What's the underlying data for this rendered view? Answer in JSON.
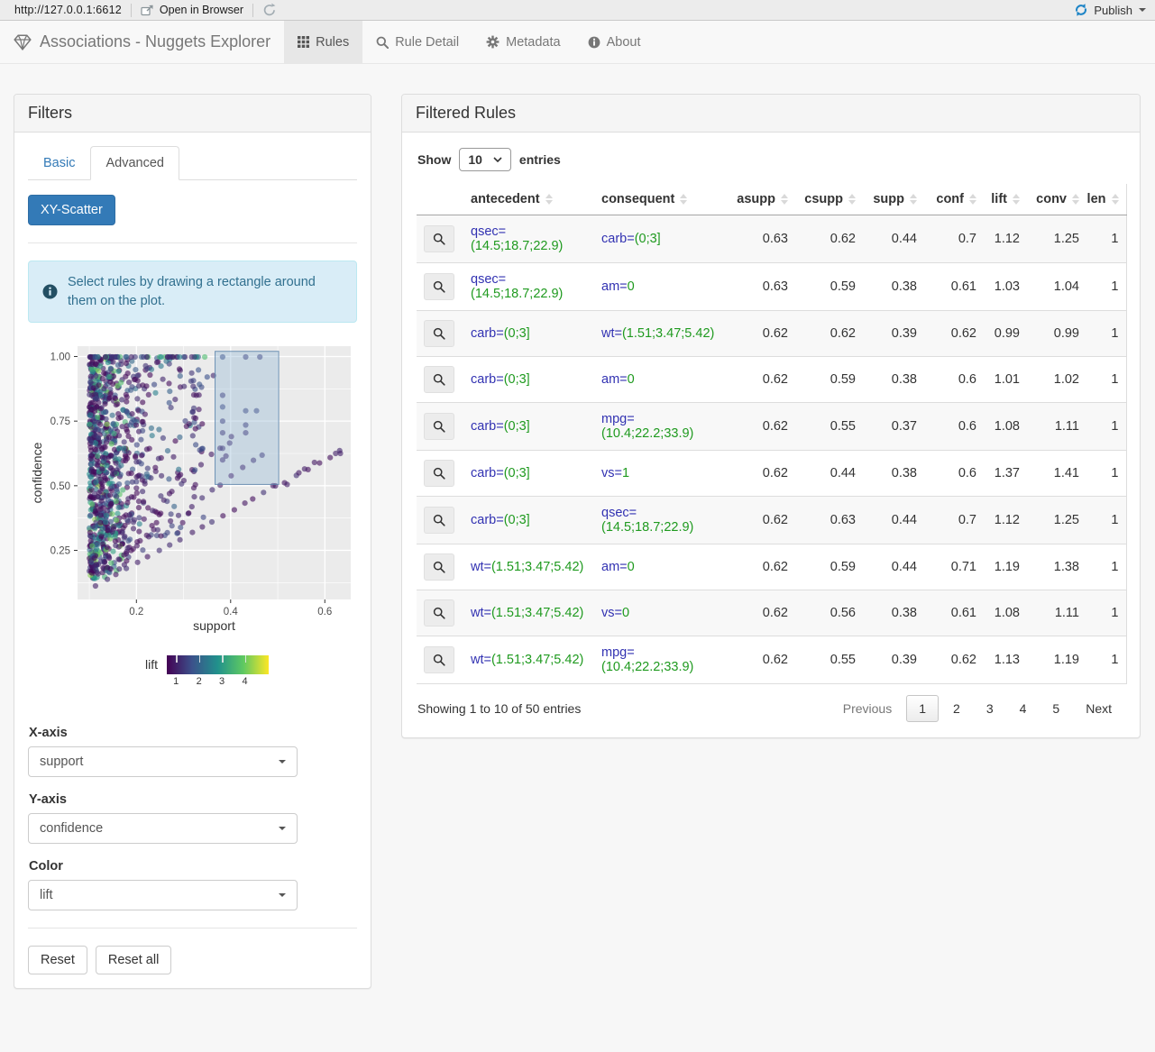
{
  "browser_bar": {
    "url": "http://127.0.0.1:6612",
    "open_in_browser": "Open in Browser",
    "publish": "Publish"
  },
  "navbar": {
    "title": "Associations - Nuggets Explorer",
    "tabs": [
      {
        "label": "Rules",
        "icon": "table-icon",
        "active": true
      },
      {
        "label": "Rule Detail",
        "icon": "search-icon",
        "active": false
      },
      {
        "label": "Metadata",
        "icon": "gear-icon",
        "active": false
      },
      {
        "label": "About",
        "icon": "info-icon",
        "active": false
      }
    ]
  },
  "filters": {
    "title": "Filters",
    "tabs": [
      {
        "label": "Basic",
        "active": false
      },
      {
        "label": "Advanced",
        "active": true
      }
    ],
    "scatter_button": "XY-Scatter",
    "info_text": "Select rules by drawing a rectangle around them on the plot.",
    "x_axis": {
      "label": "X-axis",
      "value": "support"
    },
    "y_axis": {
      "label": "Y-axis",
      "value": "confidence"
    },
    "color": {
      "label": "Color",
      "value": "lift"
    },
    "reset": "Reset",
    "reset_all": "Reset all"
  },
  "chart_data": {
    "type": "scatter",
    "xlabel": "support",
    "ylabel": "confidence",
    "xlim": [
      0.075,
      0.655
    ],
    "ylim": [
      0.06,
      1.04
    ],
    "xticks": [
      0.2,
      0.4,
      0.6
    ],
    "yticks": [
      0.25,
      0.5,
      0.75,
      1.0
    ],
    "grid": true,
    "panel_bg": "#ebebeb",
    "color_legend": {
      "label": "lift",
      "ticks": [
        1,
        2,
        3,
        4
      ],
      "domain": [
        0.6,
        5.04
      ],
      "palette": "viridis"
    },
    "selection_rect": {
      "x": [
        0.367,
        0.502
      ],
      "y": [
        0.505,
        1.02
      ]
    },
    "point_style": {
      "radius": 3.1,
      "opacity": 0.6
    },
    "generated_points": {
      "seed": 42,
      "n_cluster": 950,
      "n_top_row": 55,
      "cluster_support": [
        0.1,
        0.345
      ],
      "arms": [
        [
          1.0,
          24,
          0.63
        ],
        [
          1.33,
          17,
          0.47
        ],
        [
          1.72,
          15,
          0.4
        ]
      ],
      "n_mid_fill": 22
    },
    "selection_points": [
      [
        0.383,
        0.998,
        1.6
      ],
      [
        0.432,
        0.998,
        1.35
      ],
      [
        0.462,
        0.998,
        1.35
      ],
      [
        0.383,
        0.85,
        1.3
      ],
      [
        0.383,
        0.805,
        1.5
      ],
      [
        0.432,
        0.79,
        1.45
      ],
      [
        0.455,
        0.79,
        1.5
      ],
      [
        0.383,
        0.75,
        1.3
      ],
      [
        0.432,
        0.735,
        1.3
      ],
      [
        0.383,
        0.705,
        1.2
      ],
      [
        0.432,
        0.705,
        1.2
      ],
      [
        0.398,
        0.665,
        1.1
      ],
      [
        0.383,
        0.645,
        1.15
      ],
      [
        0.39,
        0.615,
        1.0
      ],
      [
        0.383,
        0.6,
        1.05
      ],
      [
        0.49,
        0.5,
        0.9
      ],
      [
        0.52,
        0.505,
        0.95
      ],
      [
        0.545,
        0.55,
        0.9
      ],
      [
        0.557,
        0.565,
        0.95
      ],
      [
        0.578,
        0.59,
        0.9
      ],
      [
        0.623,
        0.625,
        1.0
      ],
      [
        0.633,
        0.625,
        1.0
      ]
    ]
  },
  "table": {
    "title": "Filtered Rules",
    "show_label": "Show",
    "page_size": "10",
    "entries_label": "entries",
    "columns": [
      "antecedent",
      "consequent",
      "asupp",
      "csupp",
      "supp",
      "conf",
      "lift",
      "conv",
      "len"
    ],
    "rows": [
      {
        "antecedent": {
          "attr": "qsec=",
          "val": "(14.5;18.7;22.9)"
        },
        "consequent": {
          "attr": "carb=",
          "val": "(0;3]"
        },
        "asupp": "0.63",
        "csupp": "0.62",
        "supp": "0.44",
        "conf": "0.7",
        "lift": "1.12",
        "conv": "1.25",
        "len": "1"
      },
      {
        "antecedent": {
          "attr": "qsec=",
          "val": "(14.5;18.7;22.9)"
        },
        "consequent": {
          "attr": "am=",
          "val": "0"
        },
        "asupp": "0.63",
        "csupp": "0.59",
        "supp": "0.38",
        "conf": "0.61",
        "lift": "1.03",
        "conv": "1.04",
        "len": "1"
      },
      {
        "antecedent": {
          "attr": "carb=",
          "val": "(0;3]"
        },
        "consequent": {
          "attr": "wt=",
          "val": "(1.51;3.47;5.42)"
        },
        "asupp": "0.62",
        "csupp": "0.62",
        "supp": "0.39",
        "conf": "0.62",
        "lift": "0.99",
        "conv": "0.99",
        "len": "1"
      },
      {
        "antecedent": {
          "attr": "carb=",
          "val": "(0;3]"
        },
        "consequent": {
          "attr": "am=",
          "val": "0"
        },
        "asupp": "0.62",
        "csupp": "0.59",
        "supp": "0.38",
        "conf": "0.6",
        "lift": "1.01",
        "conv": "1.02",
        "len": "1"
      },
      {
        "antecedent": {
          "attr": "carb=",
          "val": "(0;3]"
        },
        "consequent": {
          "attr": "mpg=",
          "val": "(10.4;22.2;33.9)"
        },
        "asupp": "0.62",
        "csupp": "0.55",
        "supp": "0.37",
        "conf": "0.6",
        "lift": "1.08",
        "conv": "1.11",
        "len": "1"
      },
      {
        "antecedent": {
          "attr": "carb=",
          "val": "(0;3]"
        },
        "consequent": {
          "attr": "vs=",
          "val": "1"
        },
        "asupp": "0.62",
        "csupp": "0.44",
        "supp": "0.38",
        "conf": "0.6",
        "lift": "1.37",
        "conv": "1.41",
        "len": "1"
      },
      {
        "antecedent": {
          "attr": "carb=",
          "val": "(0;3]"
        },
        "consequent": {
          "attr": "qsec=",
          "val": "(14.5;18.7;22.9)"
        },
        "asupp": "0.62",
        "csupp": "0.63",
        "supp": "0.44",
        "conf": "0.7",
        "lift": "1.12",
        "conv": "1.25",
        "len": "1"
      },
      {
        "antecedent": {
          "attr": "wt=",
          "val": "(1.51;3.47;5.42)"
        },
        "consequent": {
          "attr": "am=",
          "val": "0"
        },
        "asupp": "0.62",
        "csupp": "0.59",
        "supp": "0.44",
        "conf": "0.71",
        "lift": "1.19",
        "conv": "1.38",
        "len": "1"
      },
      {
        "antecedent": {
          "attr": "wt=",
          "val": "(1.51;3.47;5.42)"
        },
        "consequent": {
          "attr": "vs=",
          "val": "0"
        },
        "asupp": "0.62",
        "csupp": "0.56",
        "supp": "0.38",
        "conf": "0.61",
        "lift": "1.08",
        "conv": "1.11",
        "len": "1"
      },
      {
        "antecedent": {
          "attr": "wt=",
          "val": "(1.51;3.47;5.42)"
        },
        "consequent": {
          "attr": "mpg=",
          "val": "(10.4;22.2;33.9)"
        },
        "asupp": "0.62",
        "csupp": "0.55",
        "supp": "0.39",
        "conf": "0.62",
        "lift": "1.13",
        "conv": "1.19",
        "len": "1"
      }
    ],
    "info": "Showing 1 to 10 of 50 entries",
    "pagination": {
      "previous": "Previous",
      "pages": [
        "1",
        "2",
        "3",
        "4",
        "5"
      ],
      "current": "1",
      "next": "Next"
    }
  },
  "colors": {
    "accent_blue": "#337ab7",
    "navbar_bg": "#f8f8f8",
    "panel_header_bg": "#f5f5f5",
    "alert_bg": "#d9edf7",
    "alert_text": "#31708f",
    "attr_text": "#3232b2",
    "value_text": "#1f9a1f",
    "publish_icon_blue": "#1d84c6",
    "plot_panel_bg": "#ebebeb",
    "viridis_stops": [
      "#440154",
      "#3b528b",
      "#21918c",
      "#5ec962",
      "#fde725"
    ]
  }
}
